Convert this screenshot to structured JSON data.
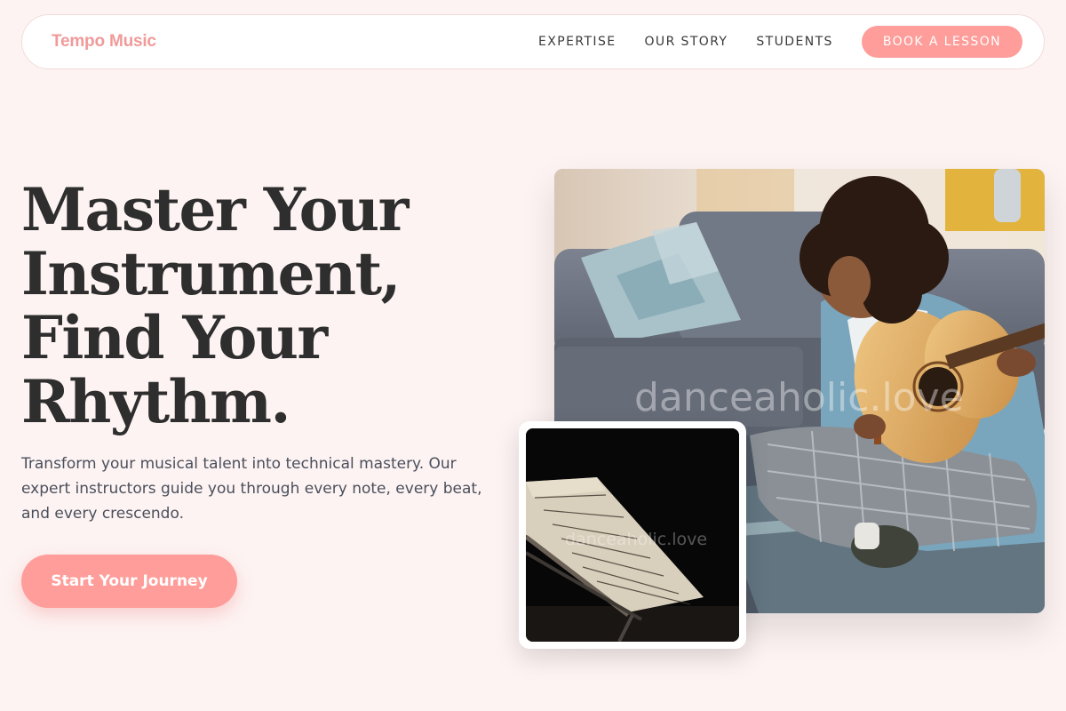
{
  "brand": {
    "name": "Tempo Music",
    "color": "#f09a9a"
  },
  "nav": {
    "links": [
      "EXPERTISE",
      "OUR STORY",
      "STUDENTS"
    ],
    "cta_label": "BOOK A LESSON"
  },
  "hero": {
    "title_lines": [
      "Master Your",
      "Instrument,",
      "Find Your",
      "Rhythm."
    ],
    "subtitle": "Transform your musical talent into technical mastery. Our expert instructors guide you through every note, every beat, and every crescendo.",
    "cta_label": "Start Your Journey"
  },
  "images": {
    "main": {
      "description": "guitar-player-photo",
      "watermark": "danceaholic.love"
    },
    "small": {
      "description": "sheet-music-stand-photo",
      "watermark": "danceaholic.love"
    }
  },
  "colors": {
    "accent": "#fe9d9a",
    "background": "#fdf3f2",
    "heading": "#2e2e2e",
    "body_text": "#4a4f5c"
  }
}
